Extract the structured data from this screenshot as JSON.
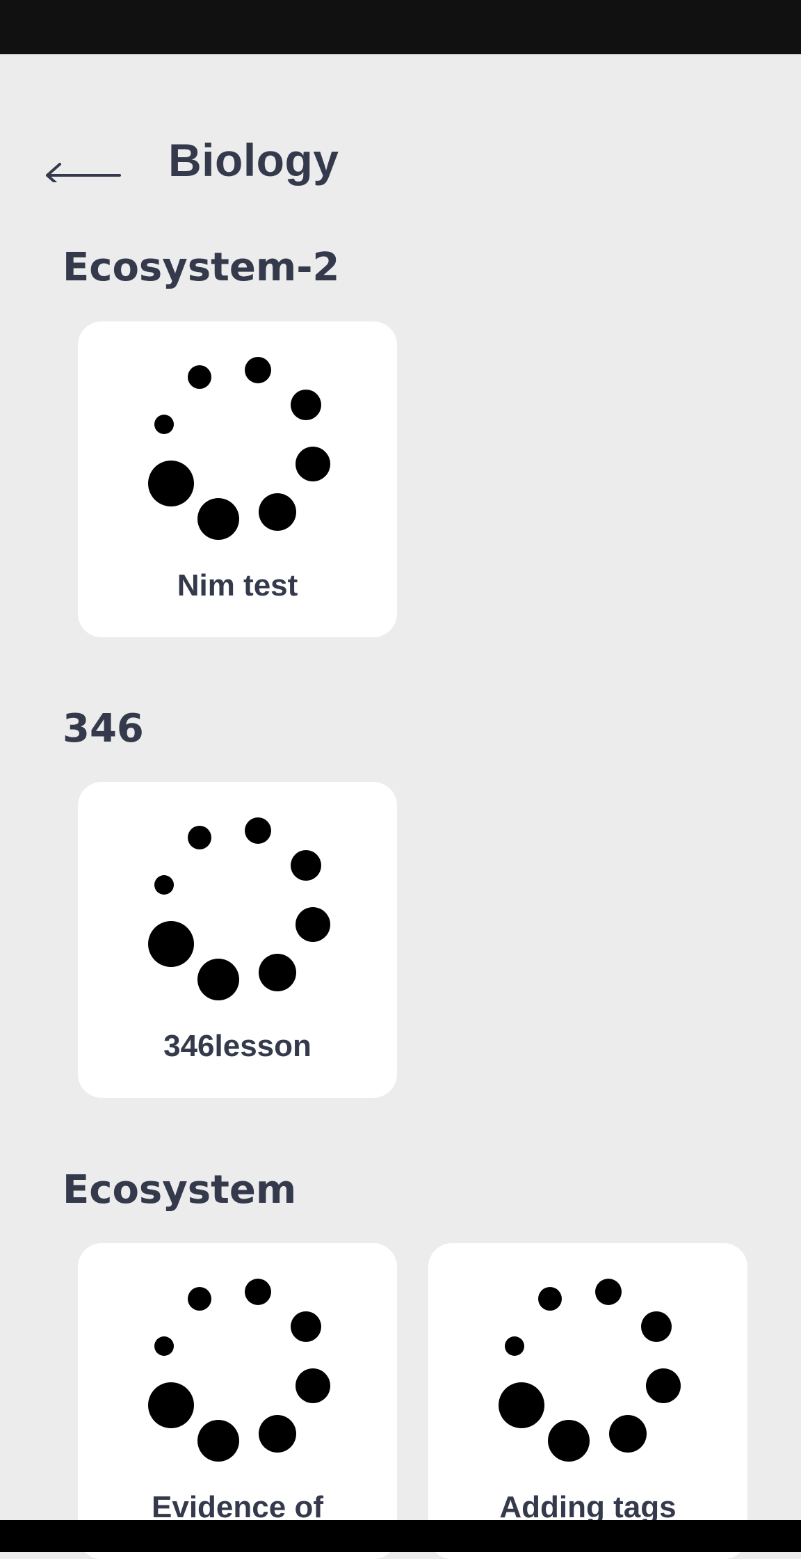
{
  "header": {
    "title": "Biology",
    "back_icon": "arrow-left-icon"
  },
  "sections": [
    {
      "title": "Ecosystem-2",
      "cards": [
        {
          "label": "Nim test",
          "icon": "loading-spinner-icon"
        }
      ]
    },
    {
      "title": "346",
      "cards": [
        {
          "label": "346lesson",
          "icon": "loading-spinner-icon"
        }
      ]
    },
    {
      "title": "Ecosystem",
      "cards": [
        {
          "label": "Evidence of",
          "icon": "loading-spinner-icon"
        },
        {
          "label": "Adding tags",
          "icon": "loading-spinner-icon"
        }
      ]
    }
  ],
  "colors": {
    "background": "#ececec",
    "card": "#ffffff",
    "text": "#343a4c",
    "status_bar": "#111111",
    "spinner": "#000000"
  }
}
